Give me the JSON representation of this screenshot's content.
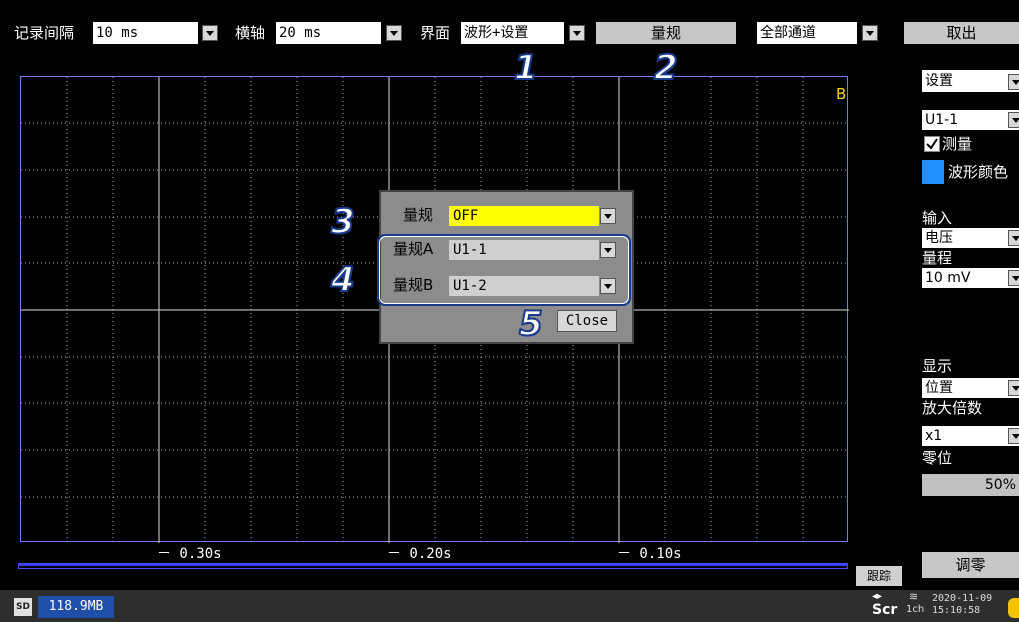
{
  "topbar": {
    "record_interval_label": "记录间隔",
    "record_interval_value": "10 ms",
    "time_axis_label": "横轴",
    "time_axis_value": "20 ms",
    "screen_label": "界面",
    "screen_value": "波形+设置",
    "cursor_button": "量规",
    "channels_value": "全部通道",
    "cancel_button": "取出"
  },
  "plot": {
    "cursor_b_marker": "B",
    "x_ticks": [
      "－ 0.30s",
      "－ 0.20s",
      "－ 0.10s"
    ],
    "trace_button": "跟踪"
  },
  "dialog": {
    "cursor_label": "量规",
    "cursor_value": "OFF",
    "cursor_a_label": "量规A",
    "cursor_a_value": "U1-1",
    "cursor_b_label": "量规B",
    "cursor_b_value": "U1-2",
    "close_button": "Close"
  },
  "callouts": [
    "1",
    "2",
    "3",
    "4",
    "5"
  ],
  "rpanel": {
    "setting_value": "设置",
    "channel_value": "U1-1",
    "measure_label": "测量",
    "measure_checked": true,
    "wave_color_label": "波形颜色",
    "wave_color": "#1e90ff",
    "input_label": "输入",
    "input_value": "电压",
    "range_label": "量程",
    "range_value": "10 mV",
    "display_label": "显示",
    "display_value": "位置",
    "zoom_label": "放大倍数",
    "zoom_value": "x1",
    "zero_label": "零位",
    "zero_value": "50%",
    "zero_adjust_button": "调零"
  },
  "bottombar": {
    "sd_icon_text": "SD",
    "memory_value": "118.9MB",
    "scr_label": "Scr",
    "ch_label": "1ch",
    "date": "2020-11-09",
    "time": "15:10:58"
  },
  "colors": {
    "plot_border": "#7a7aff",
    "cursor_value_bg": "#ffff00",
    "callout_fill": "#ffffff",
    "callout_stroke": "#1a3a8a"
  }
}
